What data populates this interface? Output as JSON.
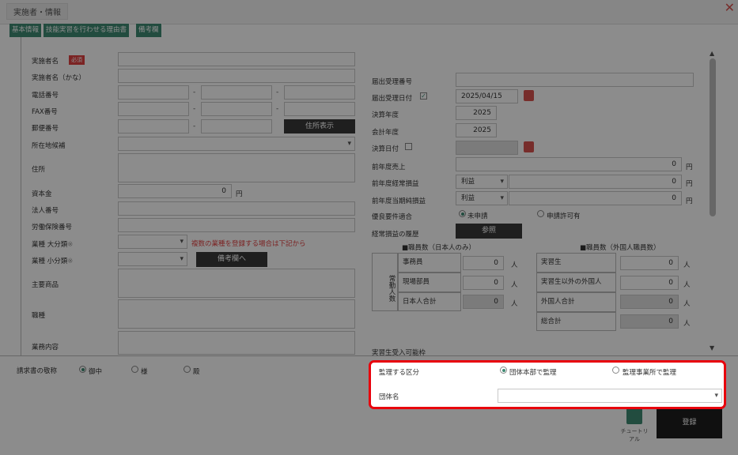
{
  "window": {
    "title": "実施者・情報"
  },
  "tabs": [
    "基本情報",
    "技能実習を行わせる理由書",
    "備考欄"
  ],
  "left": {
    "required": "必須",
    "labels": {
      "name": "実施者名",
      "name_kana": "実施者名（かな）",
      "phone": "電話番号",
      "fax": "FAX番号",
      "postal": "郵便番号",
      "prefecture": "所在地候補",
      "address": "住所",
      "capital": "資本金",
      "corp_no": "法人番号",
      "labor_ins": "労働保険番号",
      "industry_major": "業種 大分類",
      "industry_minor": "業種 小分類",
      "main_products": "主要商品",
      "job_type": "職種",
      "business": "業務内容"
    },
    "mark": "※",
    "address_btn": "住所表示",
    "capital_value": "0",
    "yen": "円",
    "multi_note": "複数の業種を登録する場合は下記から",
    "memo_btn": "備考欄へ"
  },
  "right": {
    "labels": {
      "receipt_no": "届出受理番号",
      "receipt_date": "届出受理日付",
      "fiscal_year": "決算年度",
      "accounting_year": "会計年度",
      "settlement_date": "決算日付",
      "sales": "前年度売上",
      "ordinary": "前年度経常損益",
      "net": "前年度当期純損益",
      "excellent": "優良要件適合",
      "history": "経常損益の履歴"
    },
    "receipt_date_value": "2025/04/15",
    "fiscal_year_value": "2025",
    "accounting_year_value": "2025",
    "sales_value": "0",
    "ordinary_select": "利益",
    "ordinary_value": "0",
    "net_select": "利益",
    "net_value": "0",
    "yen": "円",
    "excellent_opt1": "未申請",
    "excellent_opt2": "申請許可有",
    "history_btn": "参照",
    "staff_jp_title": "■職員数（日本人のみ）",
    "staff_foreign_title": "■職員数（外国人職員数）",
    "jokin": "常勤人数",
    "jp_rows": [
      {
        "label": "事務員",
        "value": "0"
      },
      {
        "label": "現場部員",
        "value": "0"
      },
      {
        "label": "日本人合計",
        "value": "0"
      }
    ],
    "fr_rows": [
      {
        "label": "実習生",
        "value": "0"
      },
      {
        "label": "実習生以外の外国人",
        "value": "0"
      },
      {
        "label": "外国人合計",
        "value": "0"
      },
      {
        "label": "総合計",
        "value": "0"
      }
    ],
    "person": "人",
    "next_section": "実習生受入可能枠"
  },
  "billing": {
    "label": "請求書の敬称",
    "opt1": "御中",
    "opt2": "様",
    "opt3": "殿"
  },
  "supervision": {
    "label": "監理する区分",
    "opt1": "団体本部で監理",
    "opt2": "監理事業所で監理",
    "org_label": "団体名"
  },
  "footer": {
    "tutorial": "チュートリアル",
    "register": "登録"
  }
}
